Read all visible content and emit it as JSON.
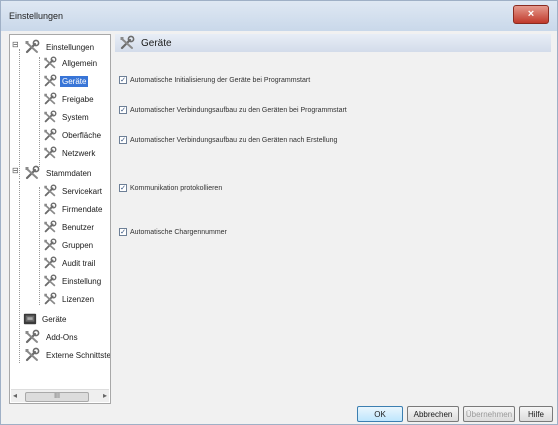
{
  "window": {
    "title": "Einstellungen",
    "close_label": "×"
  },
  "tree": {
    "root": "Einstellungen",
    "einstellungen_children": [
      "Allgemein",
      "Geräte",
      "Freigabe",
      "System",
      "Oberfläche",
      "Netzwerk"
    ],
    "selected": "Geräte",
    "stammdaten": "Stammdaten",
    "stammdaten_children": [
      "Servicekart",
      "Firmendate",
      "Benutzer",
      "Gruppen",
      "Audit trail",
      "Einstellung",
      "Lizenzen"
    ],
    "top_items": [
      "Geräte",
      "Add-Ons",
      "Externe Schnittstelle"
    ],
    "scrollbar_thumb": "III"
  },
  "content": {
    "header": "Geräte",
    "options": [
      {
        "label": "Automatische Initialisierung der Geräte bei Programmstart",
        "checked": true
      },
      {
        "label": "Automatischer Verbindungsaufbau zu den Geräten bei Programmstart",
        "checked": true
      },
      {
        "label": "Automatischer Verbindungsaufbau zu den Geräten nach Erstellung",
        "checked": true
      },
      {
        "label": "Kommunikation protokollieren",
        "checked": true
      },
      {
        "label": "Automatische Chargennummer",
        "checked": true
      }
    ]
  },
  "buttons": {
    "ok": "OK",
    "cancel": "Abbrechen",
    "apply": "Übernehmen",
    "help": "Hilfe"
  },
  "colors": {
    "selection": "#3875d7",
    "header_bg": "#d3dcea",
    "titlebar": "#c9d8ea",
    "close": "#c0392b"
  }
}
